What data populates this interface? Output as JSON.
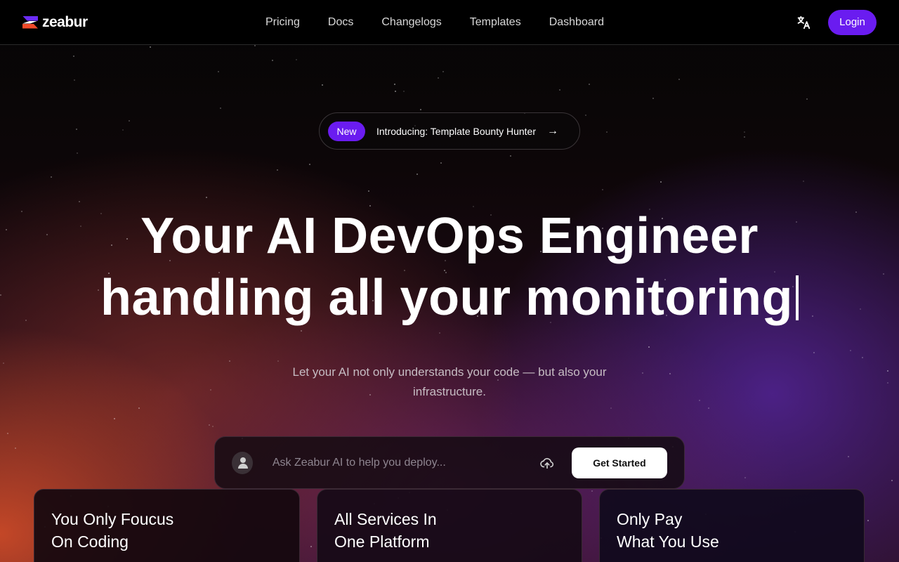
{
  "header": {
    "brand": "zeabur",
    "nav": [
      "Pricing",
      "Docs",
      "Changelogs",
      "Templates",
      "Dashboard"
    ],
    "login_label": "Login"
  },
  "banner": {
    "badge": "New",
    "text": "Introducing: Template Bounty Hunter",
    "arrow": "→"
  },
  "hero": {
    "line1": "Your AI DevOps Engineer",
    "line2": "handling all your monitoring",
    "subtitle": "Let your AI not only understands your code — but also your infrastructure."
  },
  "prompt": {
    "placeholder": "Ask Zeabur AI to help you deploy...",
    "button_label": "Get Started"
  },
  "cards": [
    {
      "title": "You Only Foucus\nOn Coding"
    },
    {
      "title": "All Services In\nOne Platform"
    },
    {
      "title": "Only Pay\nWhat You Use"
    }
  ],
  "colors": {
    "accent": "#6a1cf0",
    "logo_top": "#6b2cf5",
    "logo_bottom": "#f04a2a"
  }
}
